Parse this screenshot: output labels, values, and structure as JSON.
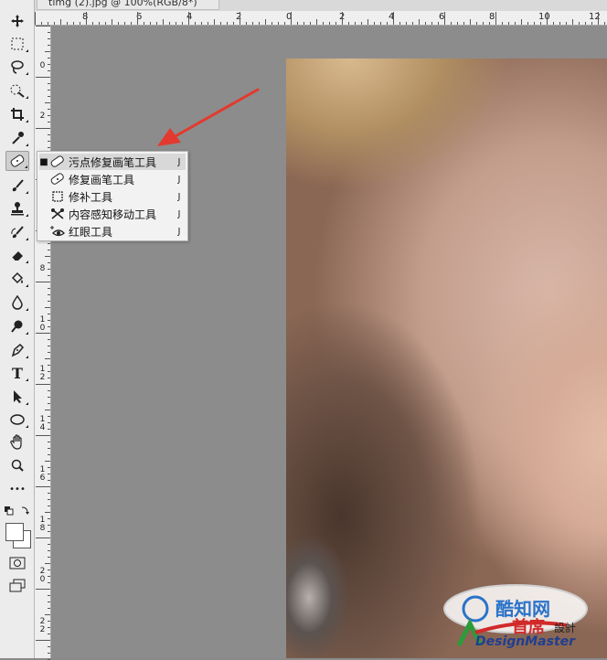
{
  "window": {
    "doc_tab_title": "timg (2).jpg @ 100%(RGB/8*)"
  },
  "ruler_top": {
    "labels": [
      "8",
      "6",
      "4",
      "2",
      "0",
      "2",
      "4",
      "6",
      "8",
      "10",
      "12"
    ]
  },
  "ruler_left": {
    "labels": [
      "0",
      "2",
      "4",
      "6",
      "8",
      "1\n0",
      "1\n2",
      "1\n4",
      "1\n6",
      "1\n8",
      "2\n0",
      "2\n2"
    ]
  },
  "toolbar": {
    "tools": [
      {
        "name": "move-tool",
        "icon": "move-icon"
      },
      {
        "name": "marquee-tool",
        "icon": "marquee-icon"
      },
      {
        "name": "lasso-tool",
        "icon": "lasso-icon"
      },
      {
        "name": "quick-select-tool",
        "icon": "quick-select-icon"
      },
      {
        "name": "crop-tool",
        "icon": "crop-icon"
      },
      {
        "name": "eyedropper-tool",
        "icon": "eyedropper-icon"
      },
      {
        "name": "spot-healing-brush-tool",
        "icon": "bandage-icon",
        "active": true
      },
      {
        "name": "brush-tool",
        "icon": "brush-icon"
      },
      {
        "name": "clone-stamp-tool",
        "icon": "stamp-icon"
      },
      {
        "name": "history-brush-tool",
        "icon": "history-brush-icon"
      },
      {
        "name": "eraser-tool",
        "icon": "eraser-icon"
      },
      {
        "name": "paint-bucket-tool",
        "icon": "bucket-icon"
      },
      {
        "name": "blur-tool",
        "icon": "drop-icon"
      },
      {
        "name": "dodge-tool",
        "icon": "dodge-icon"
      },
      {
        "name": "pen-tool",
        "icon": "pen-icon"
      },
      {
        "name": "type-tool",
        "icon": "type-icon",
        "glyph": "T"
      },
      {
        "name": "path-select-tool",
        "icon": "arrow-icon"
      },
      {
        "name": "ellipse-tool",
        "icon": "ellipse-icon"
      },
      {
        "name": "hand-tool",
        "icon": "hand-icon"
      },
      {
        "name": "zoom-tool",
        "icon": "zoom-icon"
      },
      {
        "name": "more-tools",
        "icon": "ellipsis-icon",
        "glyph": "•••"
      }
    ]
  },
  "flyout": {
    "items": [
      {
        "label": "污点修复画笔工具",
        "shortcut": "J",
        "selected": true,
        "icon": "spot-healing-icon"
      },
      {
        "label": "修复画笔工具",
        "shortcut": "J",
        "selected": false,
        "icon": "healing-brush-icon"
      },
      {
        "label": "修补工具",
        "shortcut": "J",
        "selected": false,
        "icon": "patch-icon"
      },
      {
        "label": "内容感知移动工具",
        "shortcut": "J",
        "selected": false,
        "icon": "content-aware-move-icon"
      },
      {
        "label": "红眼工具",
        "shortcut": "J",
        "selected": false,
        "icon": "red-eye-icon"
      }
    ]
  },
  "watermark": {
    "line1": "酷知网",
    "line2": "首席",
    "line3": "設計",
    "line4": "DesignMaster"
  },
  "colors": {
    "arrow": "#e23a2e",
    "toolbar": "#ececec",
    "canvas": "#8c8c8c"
  }
}
